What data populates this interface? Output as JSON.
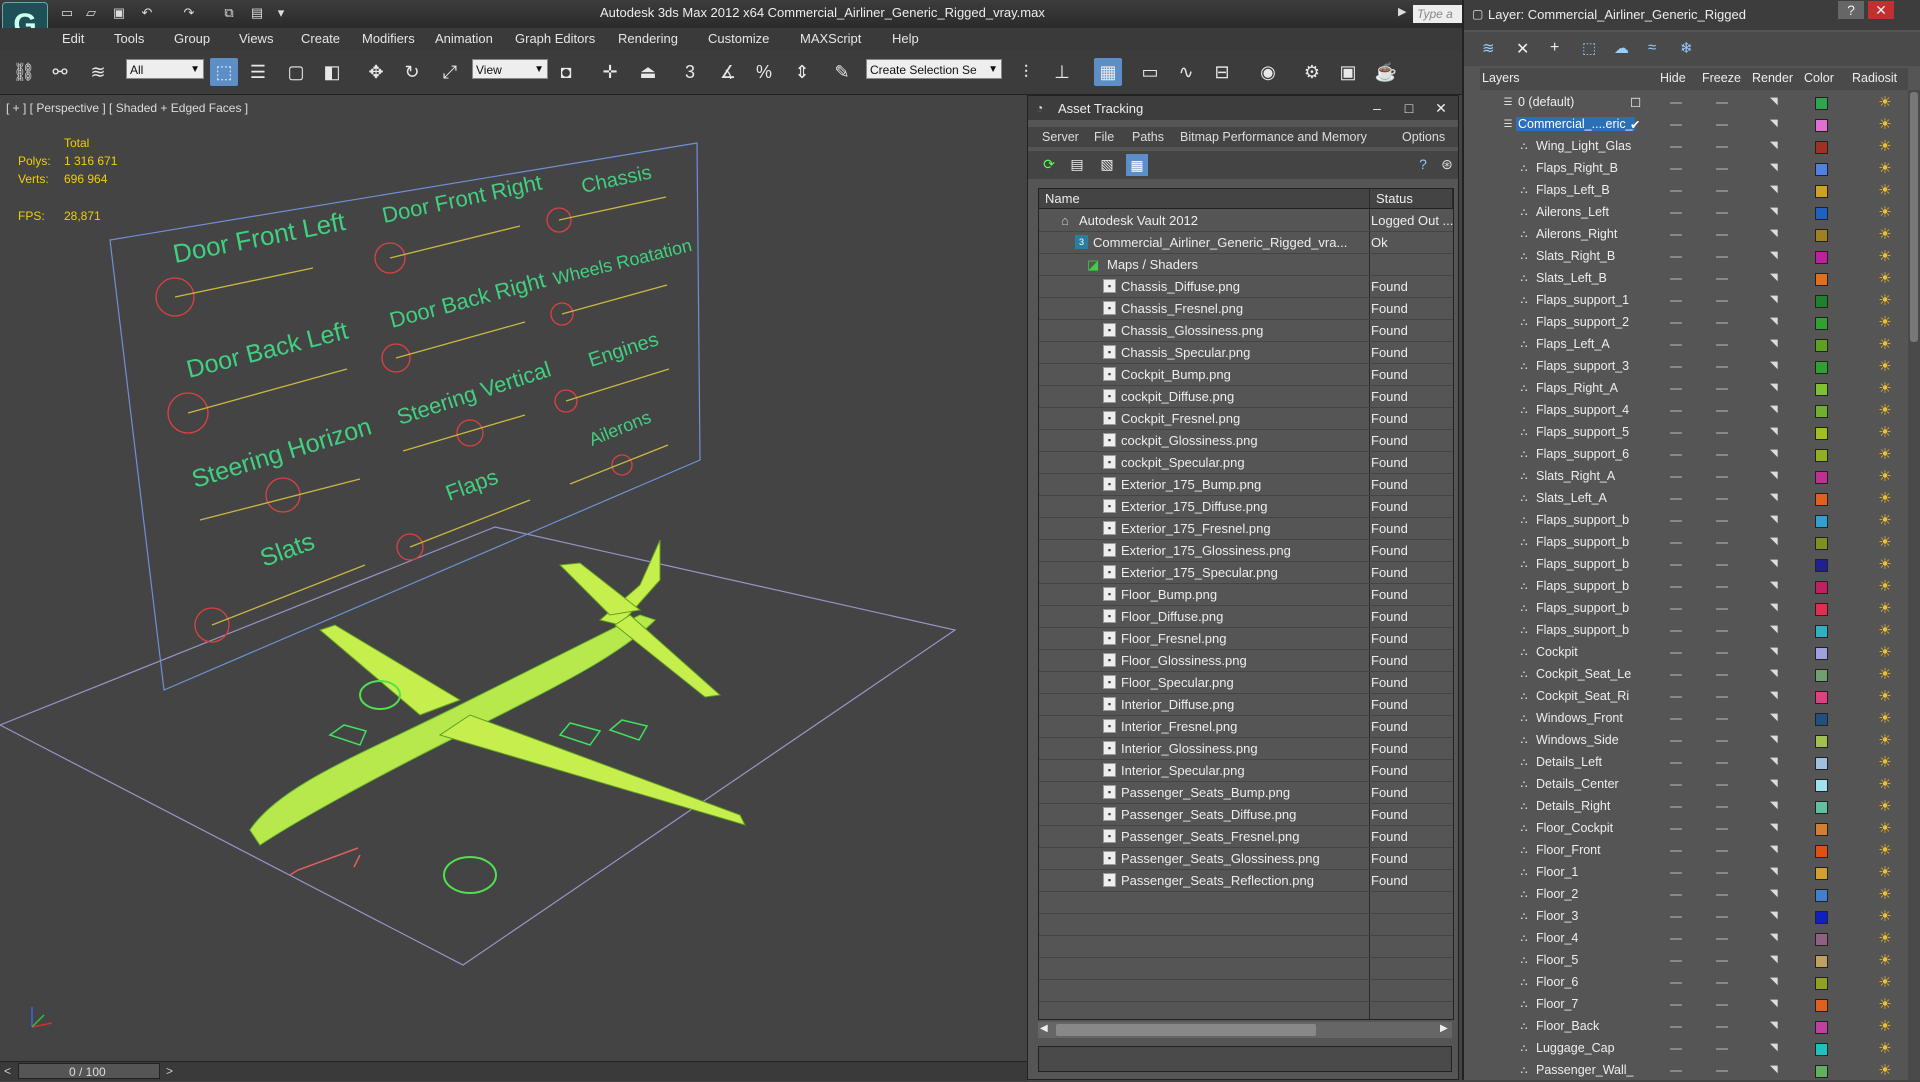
{
  "app": {
    "title": "Autodesk 3ds Max  2012 x64      Commercial_Airliner_Generic_Rigged_vray.max",
    "search_placeholder": "Type a"
  },
  "menu": [
    "Edit",
    "Tools",
    "Group",
    "Views",
    "Create",
    "Modifiers",
    "Animation",
    "Graph Editors",
    "Rendering",
    "Customize",
    "MAXScript",
    "Help"
  ],
  "toolbar": {
    "filter_select": "All",
    "ref_coord_select": "View",
    "selection_set_placeholder": "Create Selection Se",
    "snap_label": "3"
  },
  "viewport": {
    "label": "[ + ] [ Perspective ] [ Shaded + Edged Faces ]",
    "stats": {
      "total_label": "Total",
      "polys_label": "Polys:",
      "polys_value": "1 316 671",
      "verts_label": "Verts:",
      "verts_value": "696 964",
      "fps_label": "FPS:",
      "fps_value": "28,871"
    },
    "rig_controls": [
      "Door Front Left",
      "Door Front Right",
      "Chassis",
      "Door Back Left",
      "Door Back Right",
      "Wheels Roatation",
      "Steering Horizon",
      "Steering Vertical",
      "Engines",
      "Slats",
      "Flaps",
      "Ailerons"
    ]
  },
  "timeline": {
    "frame_label": "0 / 100",
    "prev": "<",
    "next": ">"
  },
  "asset_tracking": {
    "title": "Asset Tracking",
    "menu": [
      "Server",
      "File",
      "Paths",
      "Bitmap Performance and Memory",
      "Options"
    ],
    "columns": {
      "name": "Name",
      "status": "Status"
    },
    "rows": [
      {
        "name": "Autodesk Vault 2012",
        "status": "Logged Out ...",
        "indent": 0,
        "kind": "vault"
      },
      {
        "name": "Commercial_Airliner_Generic_Rigged_vra...",
        "status": "Ok",
        "indent": 1,
        "kind": "max"
      },
      {
        "name": "Maps / Shaders",
        "status": "",
        "indent": 2,
        "kind": "folder"
      },
      {
        "name": "Chassis_Diffuse.png",
        "status": "Found",
        "indent": 3,
        "kind": "file"
      },
      {
        "name": "Chassis_Fresnel.png",
        "status": "Found",
        "indent": 3,
        "kind": "file"
      },
      {
        "name": "Chassis_Glossiness.png",
        "status": "Found",
        "indent": 3,
        "kind": "file"
      },
      {
        "name": "Chassis_Specular.png",
        "status": "Found",
        "indent": 3,
        "kind": "file"
      },
      {
        "name": "Cockpit_Bump.png",
        "status": "Found",
        "indent": 3,
        "kind": "file"
      },
      {
        "name": "cockpit_Diffuse.png",
        "status": "Found",
        "indent": 3,
        "kind": "file"
      },
      {
        "name": "Cockpit_Fresnel.png",
        "status": "Found",
        "indent": 3,
        "kind": "file"
      },
      {
        "name": "cockpit_Glossiness.png",
        "status": "Found",
        "indent": 3,
        "kind": "file"
      },
      {
        "name": "cockpit_Specular.png",
        "status": "Found",
        "indent": 3,
        "kind": "file"
      },
      {
        "name": "Exterior_175_Bump.png",
        "status": "Found",
        "indent": 3,
        "kind": "file"
      },
      {
        "name": "Exterior_175_Diffuse.png",
        "status": "Found",
        "indent": 3,
        "kind": "file"
      },
      {
        "name": "Exterior_175_Fresnel.png",
        "status": "Found",
        "indent": 3,
        "kind": "file"
      },
      {
        "name": "Exterior_175_Glossiness.png",
        "status": "Found",
        "indent": 3,
        "kind": "file"
      },
      {
        "name": "Exterior_175_Specular.png",
        "status": "Found",
        "indent": 3,
        "kind": "file"
      },
      {
        "name": "Floor_Bump.png",
        "status": "Found",
        "indent": 3,
        "kind": "file"
      },
      {
        "name": "Floor_Diffuse.png",
        "status": "Found",
        "indent": 3,
        "kind": "file"
      },
      {
        "name": "Floor_Fresnel.png",
        "status": "Found",
        "indent": 3,
        "kind": "file"
      },
      {
        "name": "Floor_Glossiness.png",
        "status": "Found",
        "indent": 3,
        "kind": "file"
      },
      {
        "name": "Floor_Specular.png",
        "status": "Found",
        "indent": 3,
        "kind": "file"
      },
      {
        "name": "Interior_Diffuse.png",
        "status": "Found",
        "indent": 3,
        "kind": "file"
      },
      {
        "name": "Interior_Fresnel.png",
        "status": "Found",
        "indent": 3,
        "kind": "file"
      },
      {
        "name": "Interior_Glossiness.png",
        "status": "Found",
        "indent": 3,
        "kind": "file"
      },
      {
        "name": "Interior_Specular.png",
        "status": "Found",
        "indent": 3,
        "kind": "file"
      },
      {
        "name": "Passenger_Seats_Bump.png",
        "status": "Found",
        "indent": 3,
        "kind": "file"
      },
      {
        "name": "Passenger_Seats_Diffuse.png",
        "status": "Found",
        "indent": 3,
        "kind": "file"
      },
      {
        "name": "Passenger_Seats_Fresnel.png",
        "status": "Found",
        "indent": 3,
        "kind": "file"
      },
      {
        "name": "Passenger_Seats_Glossiness.png",
        "status": "Found",
        "indent": 3,
        "kind": "file"
      },
      {
        "name": "Passenger_Seats_Reflection.png",
        "status": "Found",
        "indent": 3,
        "kind": "file"
      }
    ]
  },
  "layer_panel": {
    "title": "Layer: Commercial_Airliner_Generic_Rigged",
    "columns": [
      "Layers",
      "Hide",
      "Freeze",
      "Render",
      "Color",
      "Radiosit"
    ],
    "layers": [
      {
        "name": "0 (default)",
        "color": "#2ea44f",
        "level": 0
      },
      {
        "name": "Commercial_....eric_",
        "color": "#e070d0",
        "level": 0,
        "selected": true
      },
      {
        "name": "Wing_Light_Glas",
        "color": "#a03020",
        "level": 1
      },
      {
        "name": "Flaps_Right_B",
        "color": "#5080e0",
        "level": 1
      },
      {
        "name": "Flaps_Left_B",
        "color": "#d0a020",
        "level": 1
      },
      {
        "name": "Ailerons_Left",
        "color": "#2060c0",
        "level": 1
      },
      {
        "name": "Ailerons_Right",
        "color": "#a08020",
        "level": 1
      },
      {
        "name": "Slats_Right_B",
        "color": "#c020a0",
        "level": 1
      },
      {
        "name": "Slats_Left_B",
        "color": "#e07020",
        "level": 1
      },
      {
        "name": "Flaps_support_1",
        "color": "#208030",
        "level": 1
      },
      {
        "name": "Flaps_support_2",
        "color": "#30a030",
        "level": 1
      },
      {
        "name": "Flaps_Left_A",
        "color": "#60a020",
        "level": 1
      },
      {
        "name": "Flaps_support_3",
        "color": "#30a030",
        "level": 1
      },
      {
        "name": "Flaps_Right_A",
        "color": "#80c030",
        "level": 1
      },
      {
        "name": "Flaps_support_4",
        "color": "#70b030",
        "level": 1
      },
      {
        "name": "Flaps_support_5",
        "color": "#a0c020",
        "level": 1
      },
      {
        "name": "Flaps_support_6",
        "color": "#90b020",
        "level": 1
      },
      {
        "name": "Slats_Right_A",
        "color": "#c03090",
        "level": 1
      },
      {
        "name": "Slats_Left_A",
        "color": "#e06020",
        "level": 1
      },
      {
        "name": "Flaps_support_b",
        "color": "#30a0d0",
        "level": 1
      },
      {
        "name": "Flaps_support_b",
        "color": "#809020",
        "level": 1
      },
      {
        "name": "Flaps_support_b",
        "color": "#202090",
        "level": 1
      },
      {
        "name": "Flaps_support_b",
        "color": "#c02060",
        "level": 1
      },
      {
        "name": "Flaps_support_b",
        "color": "#e03050",
        "level": 1
      },
      {
        "name": "Flaps_support_b",
        "color": "#30b0c0",
        "level": 1
      },
      {
        "name": "Cockpit",
        "color": "#a0a0e0",
        "level": 1
      },
      {
        "name": "Cockpit_Seat_Le",
        "color": "#70a070",
        "level": 1
      },
      {
        "name": "Cockpit_Seat_Ri",
        "color": "#e04080",
        "level": 1
      },
      {
        "name": "Windows_Front",
        "color": "#205080",
        "level": 1
      },
      {
        "name": "Windows_Side",
        "color": "#a0c050",
        "level": 1
      },
      {
        "name": "Details_Left",
        "color": "#a0c0e0",
        "level": 1
      },
      {
        "name": "Details_Center",
        "color": "#a0e0f0",
        "level": 1
      },
      {
        "name": "Details_Right",
        "color": "#60c0a0",
        "level": 1
      },
      {
        "name": "Floor_Cockpit",
        "color": "#d08030",
        "level": 1
      },
      {
        "name": "Floor_Front",
        "color": "#e05010",
        "level": 1
      },
      {
        "name": "Floor_1",
        "color": "#d0a030",
        "level": 1
      },
      {
        "name": "Floor_2",
        "color": "#4080d0",
        "level": 1
      },
      {
        "name": "Floor_3",
        "color": "#1020c0",
        "level": 1
      },
      {
        "name": "Floor_4",
        "color": "#906080",
        "level": 1
      },
      {
        "name": "Floor_5",
        "color": "#c0a060",
        "level": 1
      },
      {
        "name": "Floor_6",
        "color": "#90a020",
        "level": 1
      },
      {
        "name": "Floor_7",
        "color": "#e06020",
        "level": 1
      },
      {
        "name": "Floor_Back",
        "color": "#c040a0",
        "level": 1
      },
      {
        "name": "Luggage_Cap",
        "color": "#20c0c0",
        "level": 1
      },
      {
        "name": "Passenger_Wall_",
        "color": "#60b060",
        "level": 1
      }
    ]
  }
}
